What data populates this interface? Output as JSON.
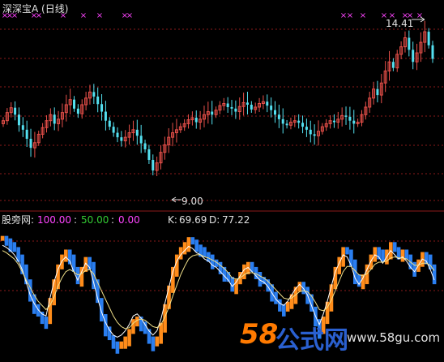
{
  "colors": {
    "background": "#000000",
    "up_candle": "#e8504a",
    "down_candle": "#54e0f0",
    "grid": "#8b1a1a",
    "signal_x": "#ff44ff",
    "k_bar_up": "#ff8c1a",
    "k_bar_down": "#2a7ef0",
    "line_k": "#ffffff",
    "line_d": "#f0e08a",
    "magenta": "#ff44ff",
    "green": "#33cc33",
    "white": "#e0e0e0",
    "watermark_orange": "#ff7a00",
    "watermark_blue": "#2a60d0"
  },
  "main_panel": {
    "title": "深深宝A (日线)",
    "high_label": "14.41",
    "low_label": "9.00",
    "signal_glyph": "×",
    "high_price": 14.41,
    "low_price": 9.0
  },
  "sub_panel": {
    "name": "股旁网",
    "param1": "100.00",
    "param2": "50.00",
    "param3": "0.00",
    "sep": ":",
    "k_label": "K:",
    "k_value": "69.69",
    "d_label": "D:",
    "d_value": "77.22",
    "levels": [
      100,
      50,
      0
    ]
  },
  "watermark": {
    "brand_num": "58",
    "brand_cn": "公式网",
    "url": "www.58gu.com"
  },
  "chart_data": [
    {
      "type": "candlestick",
      "title": "深深宝A (日线)",
      "annotations": [
        "14.41",
        "9.00"
      ],
      "close": [
        11.35,
        11.62,
        11.78,
        11.55,
        11.2,
        11.05,
        10.75,
        10.45,
        10.62,
        10.9,
        11.12,
        11.35,
        11.55,
        11.25,
        11.4,
        11.62,
        11.88,
        12.05,
        11.75,
        11.58,
        11.88,
        12.1,
        12.3,
        12.15,
        11.9,
        11.65,
        11.35,
        11.15,
        10.95,
        10.8,
        10.68,
        10.8,
        10.95,
        11.05,
        10.85,
        10.6,
        10.4,
        10.05,
        9.7,
        9.95,
        10.3,
        10.55,
        10.8,
        10.95,
        11.05,
        11.15,
        11.25,
        11.38,
        11.45,
        11.3,
        11.4,
        11.55,
        11.65,
        11.55,
        11.7,
        11.85,
        11.92,
        11.8,
        11.75,
        11.65,
        11.82,
        11.95,
        11.88,
        11.72,
        11.8,
        11.92,
        11.98,
        11.85,
        11.7,
        11.55,
        11.4,
        11.25,
        11.2,
        11.3,
        11.35,
        11.28,
        11.15,
        11.05,
        10.9,
        10.85,
        11.0,
        11.15,
        11.25,
        11.35,
        11.3,
        11.4,
        11.52,
        11.48,
        11.35,
        11.25,
        11.3,
        11.55,
        11.8,
        12.1,
        12.4,
        12.2,
        12.6,
        13.0,
        13.3,
        13.1,
        13.55,
        13.8,
        14.1,
        13.7,
        13.3,
        13.6,
        13.95,
        14.3,
        13.85,
        13.4
      ],
      "ylim": [
        9.0,
        14.41
      ]
    },
    {
      "type": "bar",
      "title": "股旁网",
      "series": [
        {
          "name": "K",
          "values": [
            95,
            93,
            90,
            86,
            80,
            72,
            60,
            48,
            40,
            34,
            30,
            28,
            45,
            60,
            72,
            80,
            84,
            80,
            70,
            62,
            70,
            78,
            74,
            60,
            45,
            32,
            22,
            15,
            10,
            8,
            10,
            14,
            20,
            28,
            30,
            26,
            20,
            14,
            10,
            14,
            25,
            40,
            55,
            70,
            80,
            86,
            90,
            94,
            92,
            88,
            86,
            82,
            80,
            76,
            74,
            70,
            66,
            62,
            56,
            60,
            66,
            72,
            74,
            70,
            66,
            62,
            60,
            56,
            50,
            44,
            40,
            38,
            42,
            48,
            54,
            58,
            54,
            48,
            38,
            28,
            20,
            30,
            42,
            56,
            70,
            78,
            86,
            84,
            76,
            64,
            58,
            64,
            72,
            80,
            86,
            84,
            78,
            84,
            90,
            86,
            82,
            84,
            80,
            74,
            70,
            76,
            82,
            80,
            72,
            62
          ]
        },
        {
          "name": "D",
          "values": [
            90,
            88,
            85,
            82,
            77,
            70,
            62,
            55,
            48,
            42,
            38,
            34,
            38,
            46,
            56,
            64,
            70,
            72,
            70,
            67,
            68,
            71,
            72,
            68,
            60,
            52,
            44,
            36,
            28,
            22,
            18,
            16,
            17,
            21,
            24,
            25,
            24,
            21,
            18,
            17,
            20,
            27,
            36,
            47,
            57,
            67,
            75,
            82,
            85,
            86,
            86,
            84,
            83,
            81,
            79,
            76,
            73,
            69,
            64,
            63,
            64,
            67,
            69,
            69,
            68,
            66,
            64,
            61,
            57,
            53,
            49,
            45,
            44,
            45,
            48,
            51,
            52,
            51,
            47,
            41,
            34,
            33,
            36,
            43,
            52,
            61,
            70,
            75,
            75,
            71,
            67,
            66,
            68,
            72,
            77,
            79,
            79,
            80,
            83,
            84,
            83,
            83,
            82,
            79,
            76,
            76,
            78,
            78,
            76,
            71
          ]
        }
      ],
      "ylim": [
        0,
        100
      ]
    }
  ]
}
